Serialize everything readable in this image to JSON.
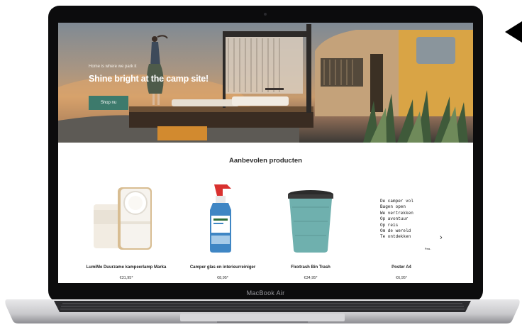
{
  "device": {
    "brand_label": "MacBook Air"
  },
  "hero": {
    "tagline": "Home is where we park it",
    "headline": "Shine bright at the camp site!",
    "cta_label": "Shop nu"
  },
  "products_section": {
    "title": "Aanbevolen producten",
    "next_icon": "›",
    "items": [
      {
        "name": "LumiMe Duurzame kampeerlamp Marka",
        "price": "€31,95*"
      },
      {
        "name": "Camper glas en interieurreiniger",
        "price": "€8,95*"
      },
      {
        "name": "Flextrash Bin Trash",
        "price": "€34,95*"
      },
      {
        "name": "Poster A4",
        "price": "€6,95*"
      }
    ],
    "poster_lines": "De camper vol\nBagen open\nWe vertrekken\nOp avontuur\nOp reis\nOm de wereld\nTe ontdekken",
    "poster_signature": "Pea."
  },
  "colors": {
    "cta": "#3d7a6c",
    "bin": "#6fb0ae",
    "cleaner": "#3f86c4"
  }
}
